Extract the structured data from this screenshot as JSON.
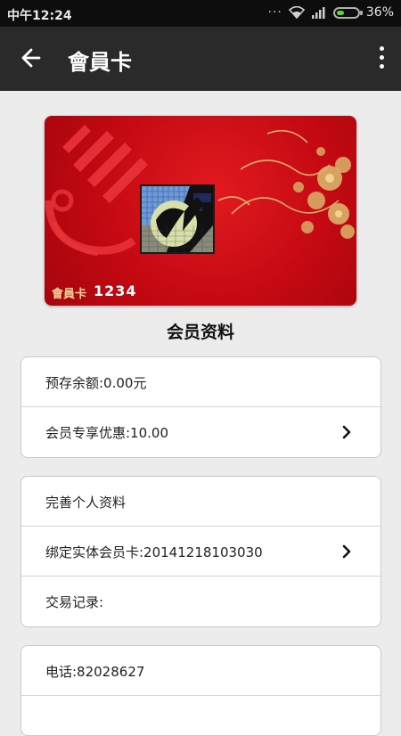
{
  "status_bar": {
    "time": "中午12:24",
    "battery_percent": "36%",
    "battery_level": 0.36
  },
  "app_bar": {
    "title": "會員卡"
  },
  "card": {
    "label": "會員卡",
    "number": "1234",
    "colors": {
      "primary": "#c40912",
      "gold": "#d9b46a"
    }
  },
  "section": {
    "title": "会员资料"
  },
  "group1": {
    "rows": [
      {
        "text": "预存余额:0.00元",
        "has_chevron": false
      },
      {
        "text": "会员专享优惠:10.00",
        "has_chevron": true
      }
    ]
  },
  "group2": {
    "rows": [
      {
        "text": "完善个人资料",
        "has_chevron": false
      },
      {
        "text": "绑定实体会员卡:20141218103030",
        "has_chevron": true
      },
      {
        "text": "交易记录:",
        "has_chevron": false
      }
    ]
  },
  "group3": {
    "rows": [
      {
        "text": "电话:82028627",
        "has_chevron": false
      }
    ]
  }
}
